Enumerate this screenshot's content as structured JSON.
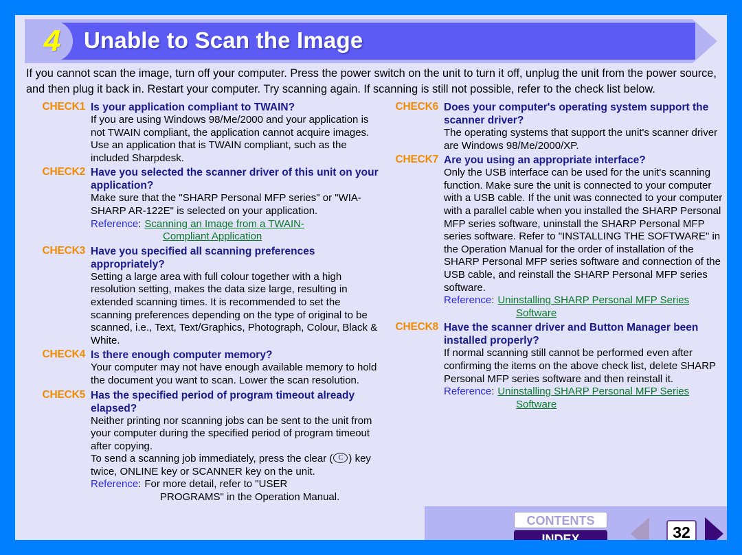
{
  "header": {
    "number": "4",
    "title": "Unable to Scan the Image"
  },
  "intro": "If you cannot scan the image, turn off your computer. Press the power switch on the unit to turn it off, unplug the unit from the power source, and then plug it back in. Restart your computer. Try scanning again. If scanning is still not possible, refer to the check list below.",
  "left_column": {
    "check1": {
      "tag": "CHECK1",
      "title": "Is your application compliant to TWAIN?",
      "body": "If you are using Windows 98/Me/2000 and your application is not TWAIN compliant, the application cannot acquire images. Use an application that is TWAIN compliant, such as the included Sharpdesk."
    },
    "check2": {
      "tag": "CHECK2",
      "title": "Have you selected the scanner driver of this unit on your application?",
      "body": "Make sure that the \"SHARP Personal MFP series\" or \"WIA-SHARP AR-122E\" is selected on your application.",
      "ref_label": "Reference",
      "ref_colon": ":",
      "ref_link_line1": "Scanning an Image from a TWAIN-",
      "ref_link_line2": "Compliant Application"
    },
    "check3": {
      "tag": "CHECK3",
      "title": "Have you specified all scanning preferences appropriately?",
      "body": "Setting a large area with full colour together with a high resolution setting, makes the data size large, resulting in extended scanning times. It is recommended to set the scanning preferences depending on the type of original to be scanned, i.e., Text, Text/Graphics, Photograph, Colour, Black & White."
    },
    "check4": {
      "tag": "CHECK4",
      "title": "Is there enough computer memory?",
      "body": "Your computer may not have enough available memory to hold the document you want to scan. Lower the scan resolution."
    },
    "check5": {
      "tag": "CHECK5",
      "title": "Has the specified period of program timeout already elapsed?",
      "body": "Neither printing nor scanning jobs can be sent to the unit from your computer during the specified period of program timeout after copying.",
      "body2_pre": "To send a scanning job immediately, press the clear (",
      "clear_key_icon": "clear-key-icon",
      "body2_post": ") key twice, ONLINE key or SCANNER key on the unit.",
      "ref_label": "Reference",
      "ref_colon": ":",
      "ref_text_line1": "For more detail, refer to \"USER",
      "ref_text_line2": "PROGRAMS\" in the Operation Manual."
    }
  },
  "right_column": {
    "check6": {
      "tag": "CHECK6",
      "title": "Does your computer's operating system support the scanner driver?",
      "body": "The operating systems that support the unit's scanner driver are Windows 98/Me/2000/XP."
    },
    "check7": {
      "tag": "CHECK7",
      "title": "Are you using an appropriate interface?",
      "body": "Only the USB interface can be used for the unit's scanning function. Make sure the unit is connected to your computer with a USB cable. If the unit was connected to your computer with a parallel cable when you installed the SHARP Personal MFP series software, uninstall the SHARP Personal MFP series software. Refer to \"INSTALLING THE SOFTWARE\" in the Operation Manual for the order of installation of the SHARP Personal MFP series software and connection of the USB cable, and reinstall the SHARP Personal MFP series software.",
      "ref_label": "Reference",
      "ref_colon": ":",
      "ref_link_line1": "Uninstalling SHARP Personal MFP Series ",
      "ref_link_line2": "Software"
    },
    "check8": {
      "tag": "CHECK8",
      "title": "Have the scanner driver and Button Manager been installed properly?",
      "body": "If normal scanning still cannot be performed even after confirming the items on the above check list, delete SHARP Personal MFP series software and then reinstall it.",
      "ref_label": "Reference",
      "ref_colon": ":",
      "ref_link_line1": "Uninstalling SHARP Personal MFP Series ",
      "ref_link_line2": "Software"
    }
  },
  "navbar": {
    "contents_label": "CONTENTS",
    "index_label": "INDEX",
    "prev_icon": "left-triangle-icon",
    "next_icon": "right-triangle-icon",
    "page_number": "32"
  },
  "colors": {
    "page_background": "#e2e2f8",
    "outer_border": "#0080ff",
    "banner": "#5c5cf5",
    "banner_accent": "#b4b4f4",
    "check_tag": "#f08c00",
    "check_title": "#1a1a8c",
    "reference_label": "#2a2ae0",
    "reference_link": "#0a7a2a",
    "index_button": "#3c0a78",
    "number_badge_text": "#ffff00"
  }
}
